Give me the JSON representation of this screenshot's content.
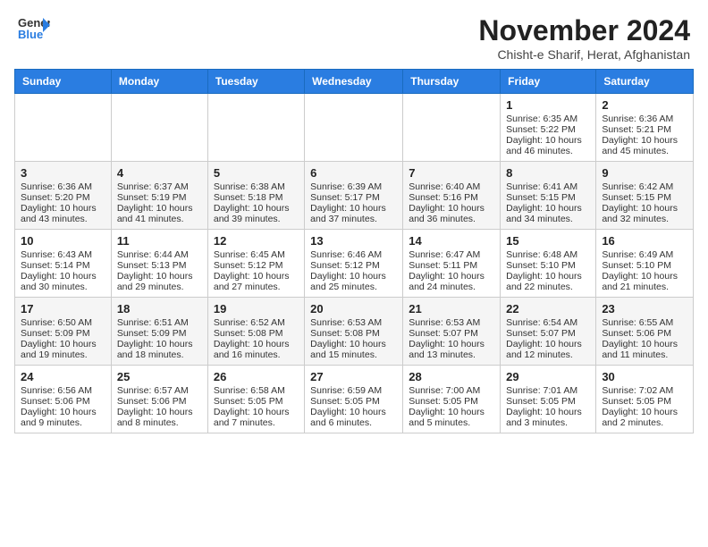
{
  "header": {
    "logo_line1": "General",
    "logo_line2": "Blue",
    "month_title": "November 2024",
    "location": "Chisht-e Sharif, Herat, Afghanistan"
  },
  "days_of_week": [
    "Sunday",
    "Monday",
    "Tuesday",
    "Wednesday",
    "Thursday",
    "Friday",
    "Saturday"
  ],
  "weeks": [
    [
      {
        "day": "",
        "info": ""
      },
      {
        "day": "",
        "info": ""
      },
      {
        "day": "",
        "info": ""
      },
      {
        "day": "",
        "info": ""
      },
      {
        "day": "",
        "info": ""
      },
      {
        "day": "1",
        "sunrise": "Sunrise: 6:35 AM",
        "sunset": "Sunset: 5:22 PM",
        "daylight": "Daylight: 10 hours and 46 minutes."
      },
      {
        "day": "2",
        "sunrise": "Sunrise: 6:36 AM",
        "sunset": "Sunset: 5:21 PM",
        "daylight": "Daylight: 10 hours and 45 minutes."
      }
    ],
    [
      {
        "day": "3",
        "sunrise": "Sunrise: 6:36 AM",
        "sunset": "Sunset: 5:20 PM",
        "daylight": "Daylight: 10 hours and 43 minutes."
      },
      {
        "day": "4",
        "sunrise": "Sunrise: 6:37 AM",
        "sunset": "Sunset: 5:19 PM",
        "daylight": "Daylight: 10 hours and 41 minutes."
      },
      {
        "day": "5",
        "sunrise": "Sunrise: 6:38 AM",
        "sunset": "Sunset: 5:18 PM",
        "daylight": "Daylight: 10 hours and 39 minutes."
      },
      {
        "day": "6",
        "sunrise": "Sunrise: 6:39 AM",
        "sunset": "Sunset: 5:17 PM",
        "daylight": "Daylight: 10 hours and 37 minutes."
      },
      {
        "day": "7",
        "sunrise": "Sunrise: 6:40 AM",
        "sunset": "Sunset: 5:16 PM",
        "daylight": "Daylight: 10 hours and 36 minutes."
      },
      {
        "day": "8",
        "sunrise": "Sunrise: 6:41 AM",
        "sunset": "Sunset: 5:15 PM",
        "daylight": "Daylight: 10 hours and 34 minutes."
      },
      {
        "day": "9",
        "sunrise": "Sunrise: 6:42 AM",
        "sunset": "Sunset: 5:15 PM",
        "daylight": "Daylight: 10 hours and 32 minutes."
      }
    ],
    [
      {
        "day": "10",
        "sunrise": "Sunrise: 6:43 AM",
        "sunset": "Sunset: 5:14 PM",
        "daylight": "Daylight: 10 hours and 30 minutes."
      },
      {
        "day": "11",
        "sunrise": "Sunrise: 6:44 AM",
        "sunset": "Sunset: 5:13 PM",
        "daylight": "Daylight: 10 hours and 29 minutes."
      },
      {
        "day": "12",
        "sunrise": "Sunrise: 6:45 AM",
        "sunset": "Sunset: 5:12 PM",
        "daylight": "Daylight: 10 hours and 27 minutes."
      },
      {
        "day": "13",
        "sunrise": "Sunrise: 6:46 AM",
        "sunset": "Sunset: 5:12 PM",
        "daylight": "Daylight: 10 hours and 25 minutes."
      },
      {
        "day": "14",
        "sunrise": "Sunrise: 6:47 AM",
        "sunset": "Sunset: 5:11 PM",
        "daylight": "Daylight: 10 hours and 24 minutes."
      },
      {
        "day": "15",
        "sunrise": "Sunrise: 6:48 AM",
        "sunset": "Sunset: 5:10 PM",
        "daylight": "Daylight: 10 hours and 22 minutes."
      },
      {
        "day": "16",
        "sunrise": "Sunrise: 6:49 AM",
        "sunset": "Sunset: 5:10 PM",
        "daylight": "Daylight: 10 hours and 21 minutes."
      }
    ],
    [
      {
        "day": "17",
        "sunrise": "Sunrise: 6:50 AM",
        "sunset": "Sunset: 5:09 PM",
        "daylight": "Daylight: 10 hours and 19 minutes."
      },
      {
        "day": "18",
        "sunrise": "Sunrise: 6:51 AM",
        "sunset": "Sunset: 5:09 PM",
        "daylight": "Daylight: 10 hours and 18 minutes."
      },
      {
        "day": "19",
        "sunrise": "Sunrise: 6:52 AM",
        "sunset": "Sunset: 5:08 PM",
        "daylight": "Daylight: 10 hours and 16 minutes."
      },
      {
        "day": "20",
        "sunrise": "Sunrise: 6:53 AM",
        "sunset": "Sunset: 5:08 PM",
        "daylight": "Daylight: 10 hours and 15 minutes."
      },
      {
        "day": "21",
        "sunrise": "Sunrise: 6:53 AM",
        "sunset": "Sunset: 5:07 PM",
        "daylight": "Daylight: 10 hours and 13 minutes."
      },
      {
        "day": "22",
        "sunrise": "Sunrise: 6:54 AM",
        "sunset": "Sunset: 5:07 PM",
        "daylight": "Daylight: 10 hours and 12 minutes."
      },
      {
        "day": "23",
        "sunrise": "Sunrise: 6:55 AM",
        "sunset": "Sunset: 5:06 PM",
        "daylight": "Daylight: 10 hours and 11 minutes."
      }
    ],
    [
      {
        "day": "24",
        "sunrise": "Sunrise: 6:56 AM",
        "sunset": "Sunset: 5:06 PM",
        "daylight": "Daylight: 10 hours and 9 minutes."
      },
      {
        "day": "25",
        "sunrise": "Sunrise: 6:57 AM",
        "sunset": "Sunset: 5:06 PM",
        "daylight": "Daylight: 10 hours and 8 minutes."
      },
      {
        "day": "26",
        "sunrise": "Sunrise: 6:58 AM",
        "sunset": "Sunset: 5:05 PM",
        "daylight": "Daylight: 10 hours and 7 minutes."
      },
      {
        "day": "27",
        "sunrise": "Sunrise: 6:59 AM",
        "sunset": "Sunset: 5:05 PM",
        "daylight": "Daylight: 10 hours and 6 minutes."
      },
      {
        "day": "28",
        "sunrise": "Sunrise: 7:00 AM",
        "sunset": "Sunset: 5:05 PM",
        "daylight": "Daylight: 10 hours and 5 minutes."
      },
      {
        "day": "29",
        "sunrise": "Sunrise: 7:01 AM",
        "sunset": "Sunset: 5:05 PM",
        "daylight": "Daylight: 10 hours and 3 minutes."
      },
      {
        "day": "30",
        "sunrise": "Sunrise: 7:02 AM",
        "sunset": "Sunset: 5:05 PM",
        "daylight": "Daylight: 10 hours and 2 minutes."
      }
    ]
  ]
}
